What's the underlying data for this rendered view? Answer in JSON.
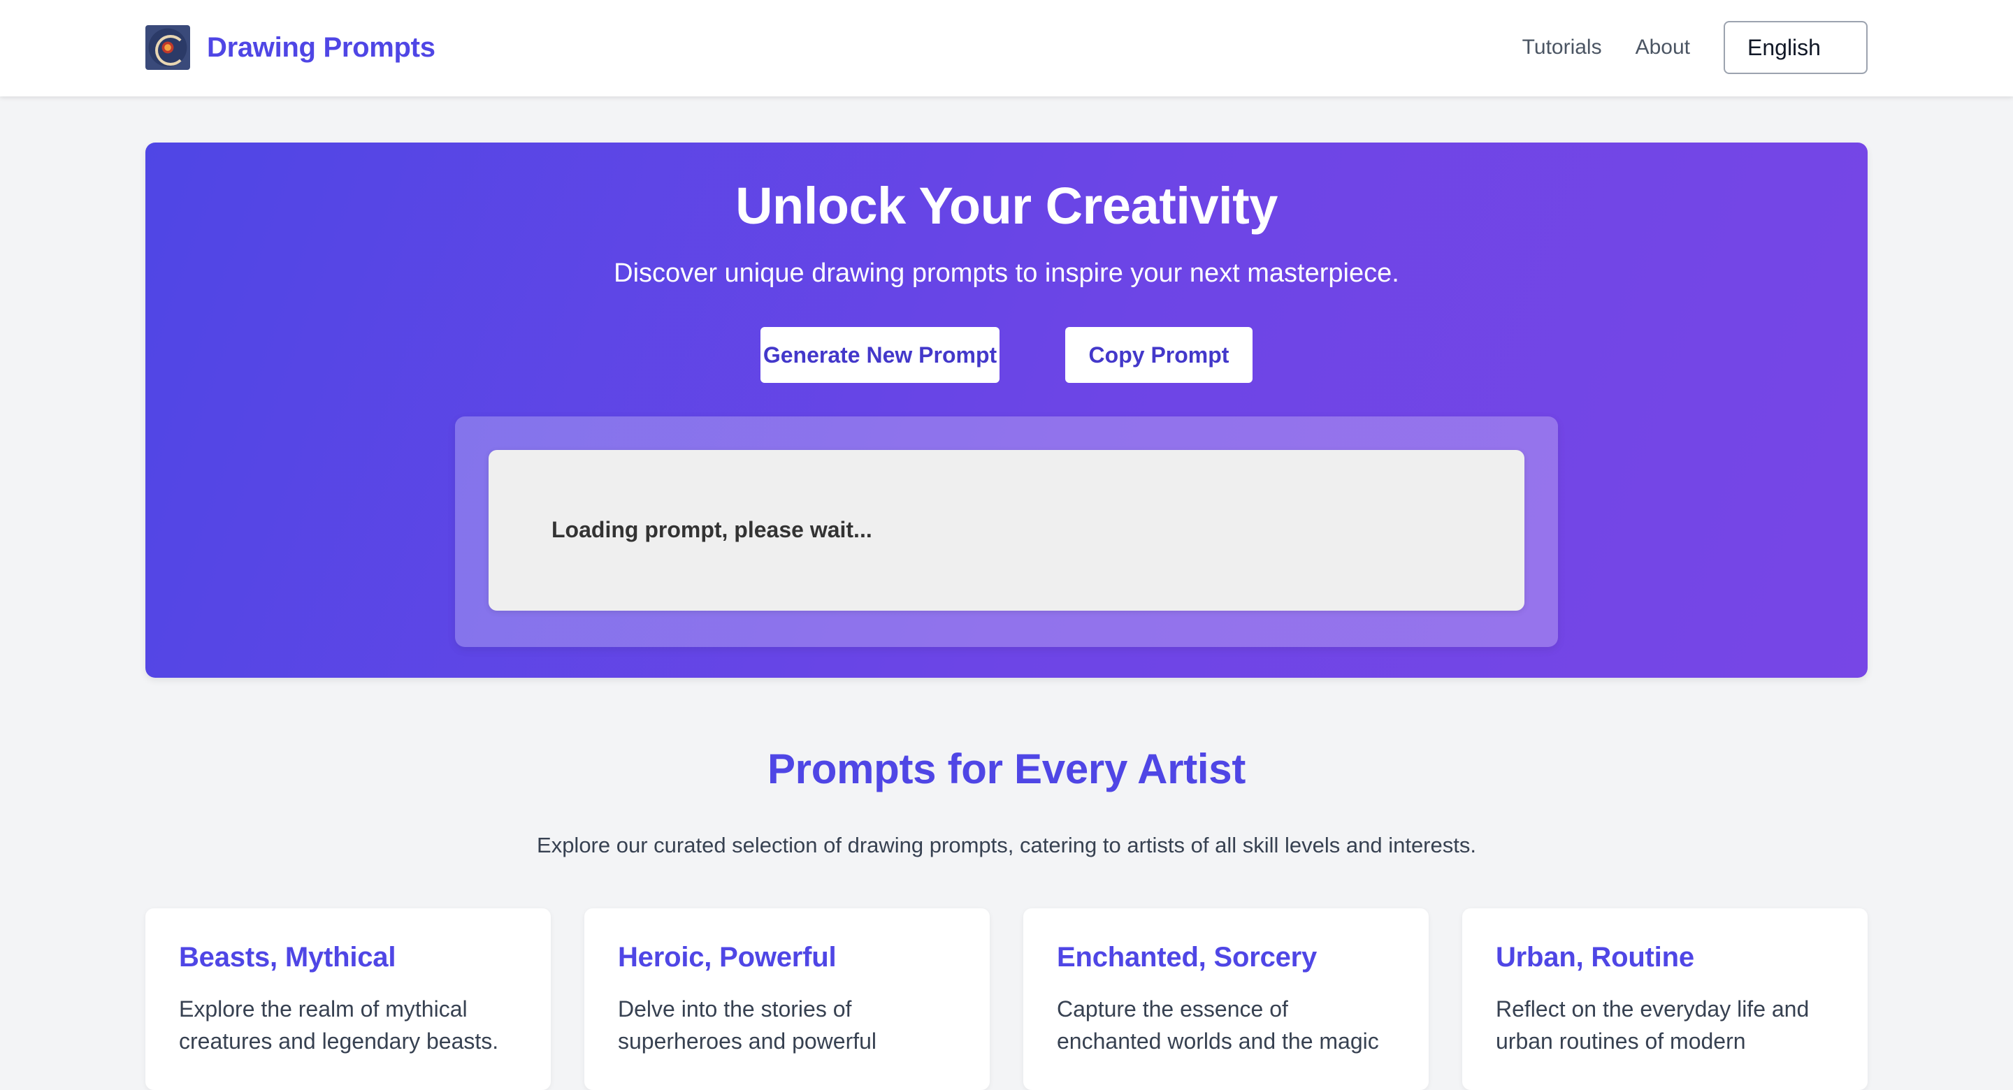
{
  "header": {
    "brand_name": "Drawing Prompts",
    "nav": [
      "Tutorials",
      "About"
    ],
    "language": "English"
  },
  "hero": {
    "title": "Unlock Your Creativity",
    "subtitle": "Discover unique drawing prompts to inspire your next masterpiece.",
    "generate_label": "Generate New Prompt",
    "copy_label": "Copy Prompt",
    "prompt_text": "Loading prompt, please wait..."
  },
  "section": {
    "title": "Prompts for Every Artist",
    "subtitle": "Explore our curated selection of drawing prompts, catering to artists of all skill levels and interests."
  },
  "cards": [
    {
      "title": "Beasts, Mythical",
      "description": "Explore the realm of mythical creatures and legendary beasts."
    },
    {
      "title": "Heroic, Powerful",
      "description": "Delve into the stories of superheroes and powerful"
    },
    {
      "title": "Enchanted, Sorcery",
      "description": "Capture the essence of enchanted worlds and the magic"
    },
    {
      "title": "Urban, Routine",
      "description": "Reflect on the everyday life and urban routines of modern"
    }
  ],
  "colors": {
    "accent": "#4f46e5",
    "hero_gradient_start": "#4f46e5",
    "hero_gradient_end": "#7746e6",
    "page_background": "#f3f4f6"
  },
  "icons": {
    "logo": "drawing-prompts-logo-icon"
  }
}
